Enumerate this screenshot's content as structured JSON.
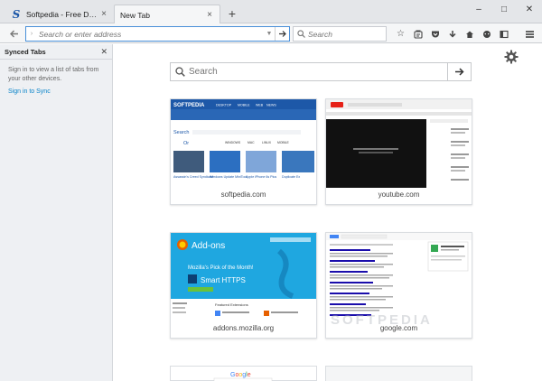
{
  "tabs": [
    {
      "title": "Softpedia - Free Download...",
      "active": false
    },
    {
      "title": "New Tab",
      "active": true
    }
  ],
  "window_controls": [
    "–",
    "□",
    "✕"
  ],
  "navbar": {
    "url_placeholder": "Search or enter address",
    "search_placeholder": "Search"
  },
  "icons": [
    "star-icon",
    "reading-list-icon",
    "pocket-icon",
    "download-icon",
    "home-icon",
    "chat-icon",
    "sidebar-icon",
    "hamburger-menu-icon"
  ],
  "sidebar": {
    "title": "Synced Tabs",
    "message": "Sign in to view a list of tabs from your other devices.",
    "link": "Sign in to Sync"
  },
  "newtab": {
    "search_placeholder": "Search",
    "tiles": [
      {
        "label": "softpedia.com"
      },
      {
        "label": "youtube.com"
      },
      {
        "label": "addons.mozilla.org"
      },
      {
        "label": "google.com"
      }
    ],
    "softpedia_thumb": {
      "logo": "SOFTPEDIA",
      "nav": [
        "DESKTOP",
        "MOBILE",
        "WEB",
        "NEWS"
      ],
      "search": "Search",
      "or": "Or",
      "platforms": [
        "WINDOWS",
        "MAC",
        "LINUX",
        "MOBILE"
      ],
      "apps": [
        "Assassin's Creed Syndicate",
        "Windows Update MiniTool",
        "Apple iPhone 6s Plus",
        "Duplicate Ex"
      ]
    },
    "addons_thumb": {
      "title": "Add-ons",
      "pick": "Mozilla's Pick of the Month!",
      "name": "Smart HTTPS",
      "featured": "Featured Extensions"
    }
  },
  "watermark": "SOFTPEDIA",
  "colors": {
    "accent": "#0a84c9",
    "url_focus": "#4a90d9",
    "softpedia_blue": "#1d58a8",
    "addons_blue": "#1fa7e0",
    "youtube_red": "#e62117"
  }
}
